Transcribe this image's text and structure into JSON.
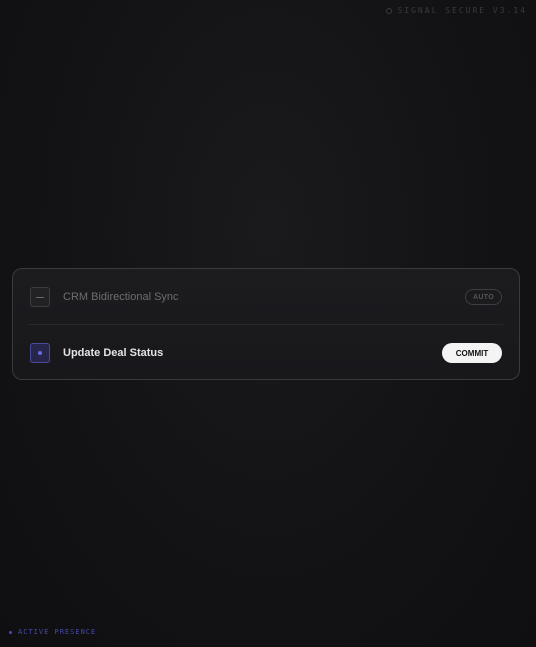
{
  "header": {
    "system_label": "SIGNAL SECURE V3.14"
  },
  "tasks": [
    {
      "label": "CRM Bidirectional Sync",
      "badge": "AUTO",
      "state": "disabled",
      "icon": "dash-icon"
    },
    {
      "label": "Update Deal Status",
      "action": "COMMIT",
      "state": "active",
      "icon": "dot-icon"
    }
  ],
  "footer": {
    "presence_label": "ACTIVE PRESENCE"
  },
  "colors": {
    "background": "#121214",
    "card_border": "#3a3a3e",
    "accent": "#4a4ac0",
    "commit_bg": "#f4f4f4"
  }
}
